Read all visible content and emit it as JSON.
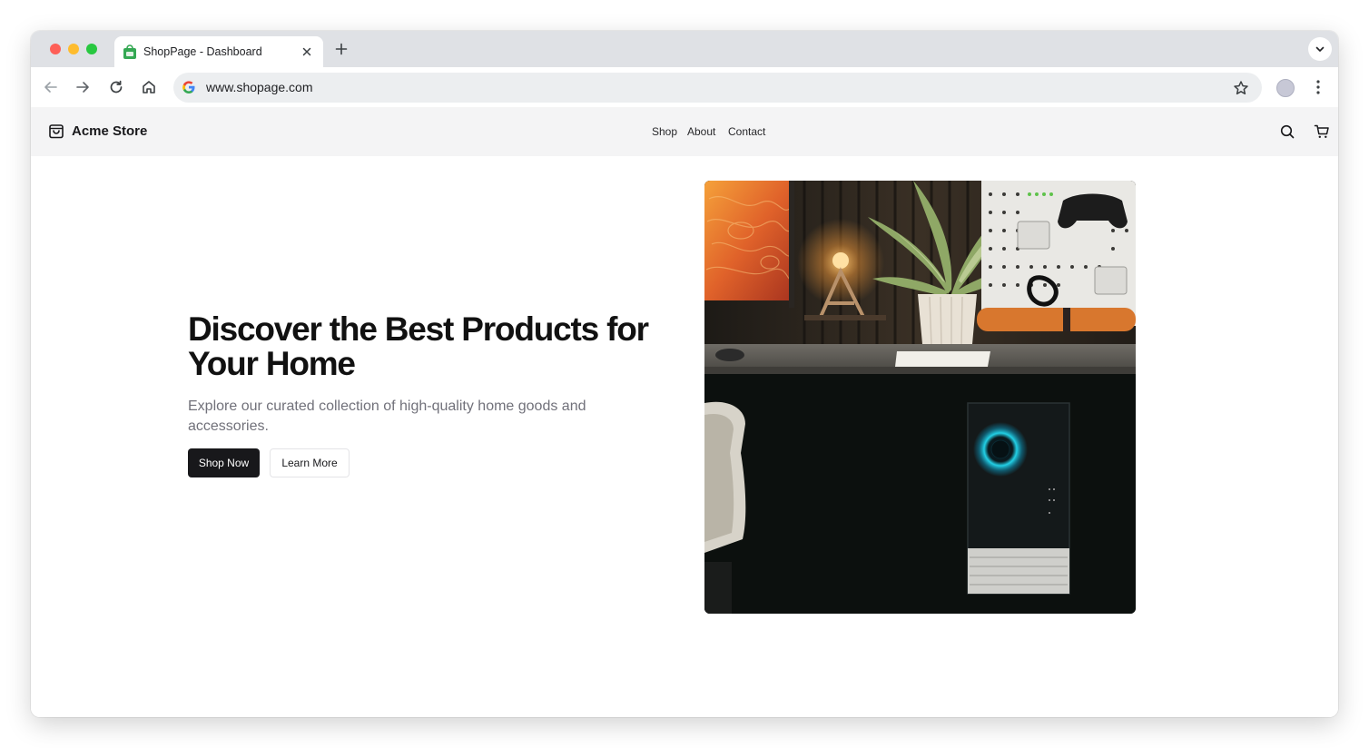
{
  "browser": {
    "tab": {
      "title": "ShopPage - Dashboard"
    },
    "url": "www.shopage.com"
  },
  "site": {
    "brand": "Acme Store",
    "nav": [
      "Shop",
      "About",
      "Contact"
    ]
  },
  "hero": {
    "title": "Discover the Best Products for Your Home",
    "subtitle": "Explore our curated collection of high-quality home goods and accessories.",
    "primary_cta": "Shop Now",
    "secondary_cta": "Learn More"
  },
  "colors": {
    "tab_strip": "#dfe1e5",
    "header_bg": "#f4f4f5",
    "primary_button": "#18181b",
    "subtitle_text": "#71717a"
  },
  "icons": [
    "favicon-icon",
    "close-icon",
    "plus-icon",
    "chevron-down-icon",
    "back-icon",
    "forward-icon",
    "reload-icon",
    "home-icon",
    "google-icon",
    "star-icon",
    "profile-icon",
    "menu-icon",
    "bag-icon",
    "search-icon",
    "cart-icon"
  ]
}
